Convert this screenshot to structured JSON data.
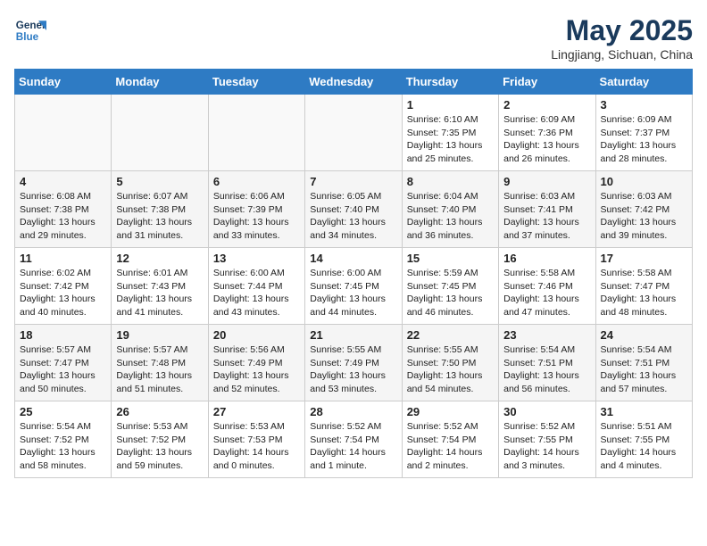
{
  "header": {
    "logo_line1": "General",
    "logo_line2": "Blue",
    "month": "May 2025",
    "location": "Lingjiang, Sichuan, China"
  },
  "days_of_week": [
    "Sunday",
    "Monday",
    "Tuesday",
    "Wednesday",
    "Thursday",
    "Friday",
    "Saturday"
  ],
  "weeks": [
    [
      {
        "day": "",
        "content": ""
      },
      {
        "day": "",
        "content": ""
      },
      {
        "day": "",
        "content": ""
      },
      {
        "day": "",
        "content": ""
      },
      {
        "day": "1",
        "content": "Sunrise: 6:10 AM\nSunset: 7:35 PM\nDaylight: 13 hours\nand 25 minutes."
      },
      {
        "day": "2",
        "content": "Sunrise: 6:09 AM\nSunset: 7:36 PM\nDaylight: 13 hours\nand 26 minutes."
      },
      {
        "day": "3",
        "content": "Sunrise: 6:09 AM\nSunset: 7:37 PM\nDaylight: 13 hours\nand 28 minutes."
      }
    ],
    [
      {
        "day": "4",
        "content": "Sunrise: 6:08 AM\nSunset: 7:38 PM\nDaylight: 13 hours\nand 29 minutes."
      },
      {
        "day": "5",
        "content": "Sunrise: 6:07 AM\nSunset: 7:38 PM\nDaylight: 13 hours\nand 31 minutes."
      },
      {
        "day": "6",
        "content": "Sunrise: 6:06 AM\nSunset: 7:39 PM\nDaylight: 13 hours\nand 33 minutes."
      },
      {
        "day": "7",
        "content": "Sunrise: 6:05 AM\nSunset: 7:40 PM\nDaylight: 13 hours\nand 34 minutes."
      },
      {
        "day": "8",
        "content": "Sunrise: 6:04 AM\nSunset: 7:40 PM\nDaylight: 13 hours\nand 36 minutes."
      },
      {
        "day": "9",
        "content": "Sunrise: 6:03 AM\nSunset: 7:41 PM\nDaylight: 13 hours\nand 37 minutes."
      },
      {
        "day": "10",
        "content": "Sunrise: 6:03 AM\nSunset: 7:42 PM\nDaylight: 13 hours\nand 39 minutes."
      }
    ],
    [
      {
        "day": "11",
        "content": "Sunrise: 6:02 AM\nSunset: 7:42 PM\nDaylight: 13 hours\nand 40 minutes."
      },
      {
        "day": "12",
        "content": "Sunrise: 6:01 AM\nSunset: 7:43 PM\nDaylight: 13 hours\nand 41 minutes."
      },
      {
        "day": "13",
        "content": "Sunrise: 6:00 AM\nSunset: 7:44 PM\nDaylight: 13 hours\nand 43 minutes."
      },
      {
        "day": "14",
        "content": "Sunrise: 6:00 AM\nSunset: 7:45 PM\nDaylight: 13 hours\nand 44 minutes."
      },
      {
        "day": "15",
        "content": "Sunrise: 5:59 AM\nSunset: 7:45 PM\nDaylight: 13 hours\nand 46 minutes."
      },
      {
        "day": "16",
        "content": "Sunrise: 5:58 AM\nSunset: 7:46 PM\nDaylight: 13 hours\nand 47 minutes."
      },
      {
        "day": "17",
        "content": "Sunrise: 5:58 AM\nSunset: 7:47 PM\nDaylight: 13 hours\nand 48 minutes."
      }
    ],
    [
      {
        "day": "18",
        "content": "Sunrise: 5:57 AM\nSunset: 7:47 PM\nDaylight: 13 hours\nand 50 minutes."
      },
      {
        "day": "19",
        "content": "Sunrise: 5:57 AM\nSunset: 7:48 PM\nDaylight: 13 hours\nand 51 minutes."
      },
      {
        "day": "20",
        "content": "Sunrise: 5:56 AM\nSunset: 7:49 PM\nDaylight: 13 hours\nand 52 minutes."
      },
      {
        "day": "21",
        "content": "Sunrise: 5:55 AM\nSunset: 7:49 PM\nDaylight: 13 hours\nand 53 minutes."
      },
      {
        "day": "22",
        "content": "Sunrise: 5:55 AM\nSunset: 7:50 PM\nDaylight: 13 hours\nand 54 minutes."
      },
      {
        "day": "23",
        "content": "Sunrise: 5:54 AM\nSunset: 7:51 PM\nDaylight: 13 hours\nand 56 minutes."
      },
      {
        "day": "24",
        "content": "Sunrise: 5:54 AM\nSunset: 7:51 PM\nDaylight: 13 hours\nand 57 minutes."
      }
    ],
    [
      {
        "day": "25",
        "content": "Sunrise: 5:54 AM\nSunset: 7:52 PM\nDaylight: 13 hours\nand 58 minutes."
      },
      {
        "day": "26",
        "content": "Sunrise: 5:53 AM\nSunset: 7:52 PM\nDaylight: 13 hours\nand 59 minutes."
      },
      {
        "day": "27",
        "content": "Sunrise: 5:53 AM\nSunset: 7:53 PM\nDaylight: 14 hours\nand 0 minutes."
      },
      {
        "day": "28",
        "content": "Sunrise: 5:52 AM\nSunset: 7:54 PM\nDaylight: 14 hours\nand 1 minute."
      },
      {
        "day": "29",
        "content": "Sunrise: 5:52 AM\nSunset: 7:54 PM\nDaylight: 14 hours\nand 2 minutes."
      },
      {
        "day": "30",
        "content": "Sunrise: 5:52 AM\nSunset: 7:55 PM\nDaylight: 14 hours\nand 3 minutes."
      },
      {
        "day": "31",
        "content": "Sunrise: 5:51 AM\nSunset: 7:55 PM\nDaylight: 14 hours\nand 4 minutes."
      }
    ]
  ]
}
